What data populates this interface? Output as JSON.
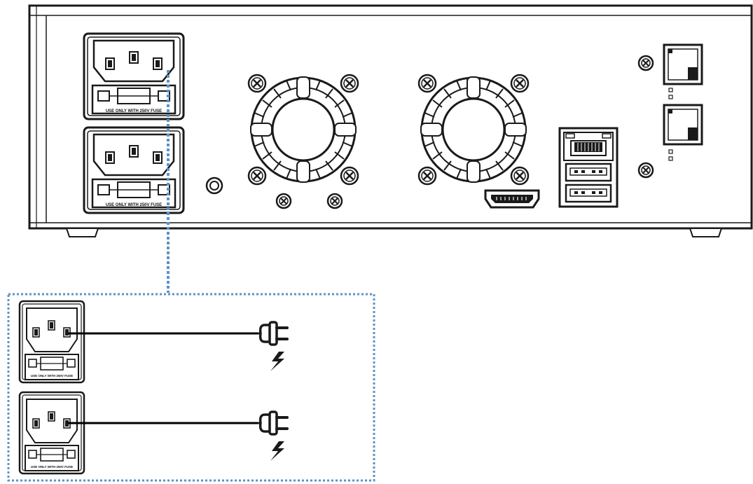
{
  "diagram": {
    "fuse_label": "USE ONLY WITH 250V FUSE",
    "colors": {
      "line": "#1a1a1a",
      "panel_fill": "#ffffff",
      "detail_fill": "#e8e8e8",
      "dotted_connector": "#5b93c7",
      "cable": "#000000"
    },
    "icons": [
      "power-inlet-icon",
      "fan-icon",
      "screw-icon",
      "ground-terminal-icon",
      "hdmi-port-icon",
      "rj45-port-icon",
      "usb-port-icon",
      "sfp-port-icon",
      "power-plug-icon",
      "lightning-icon"
    ]
  }
}
